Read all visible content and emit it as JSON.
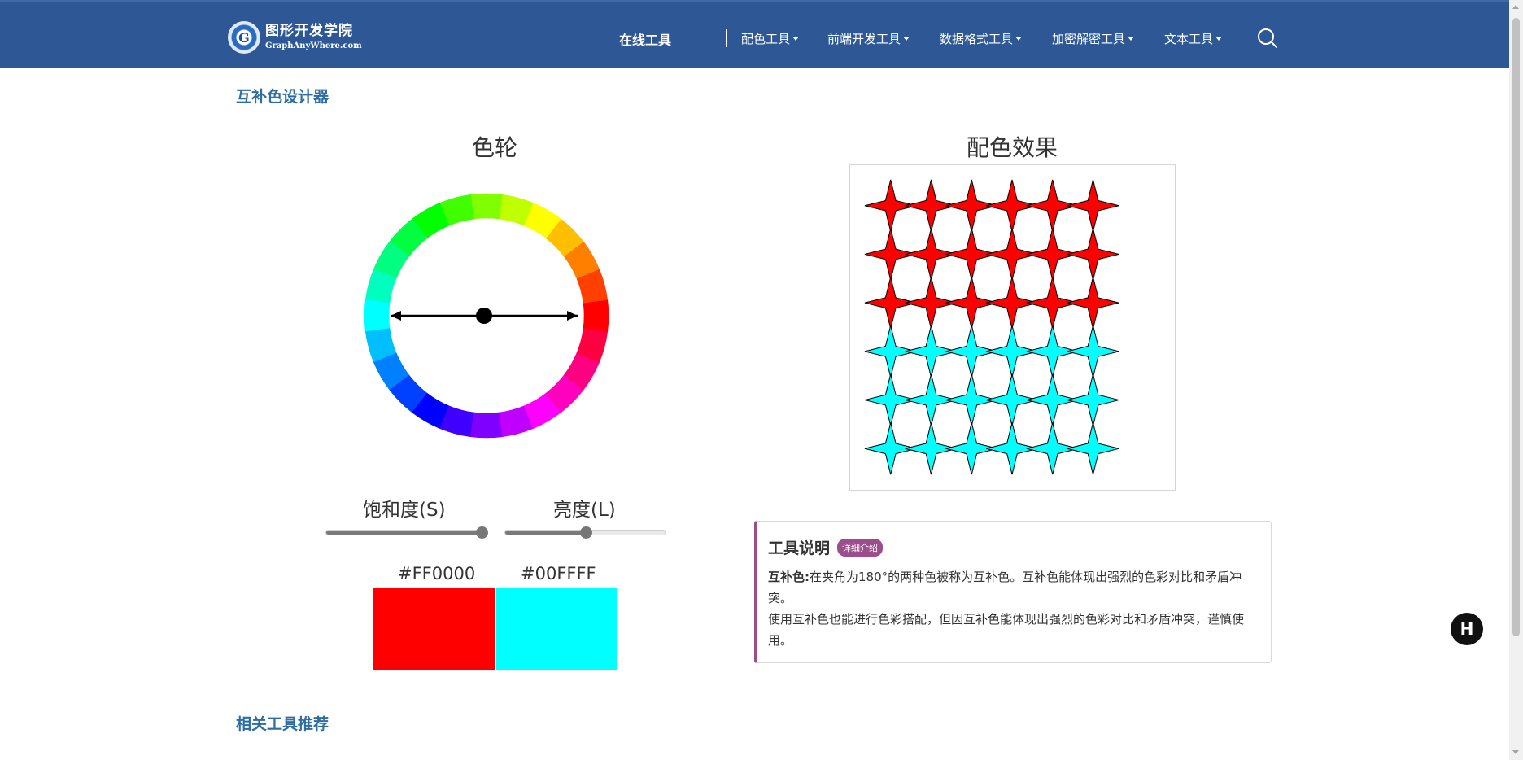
{
  "header": {
    "logo_cn": "图形开发学院",
    "logo_en": "GraphAnyWhere.com",
    "logo_icon": "logo-globe-icon",
    "nav_online": "在线工具",
    "nav_items": [
      "配色工具",
      "前端开发工具",
      "数据格式工具",
      "加密解密工具",
      "文本工具"
    ],
    "search_icon": "search-icon",
    "bg_color": "#2d5795"
  },
  "page": {
    "title": "互补色设计器",
    "related_title": "相关工具推荐"
  },
  "wheel": {
    "heading": "色轮",
    "segments": 24,
    "selected_hue_deg": 0,
    "complement_hue_deg": 180
  },
  "effect": {
    "heading": "配色效果",
    "grid_cols": 6,
    "grid_rows": 6,
    "top_rows": 3,
    "color_primary": "#FF0000",
    "color_complement": "#00FFFF"
  },
  "controls": {
    "saturation_label": "饱和度(S)",
    "saturation_value": 1.0,
    "lightness_label": "亮度(L)",
    "lightness_value": 0.5
  },
  "colors": {
    "primary_hex": "#FF0000",
    "complement_hex": "#00FFFF"
  },
  "info": {
    "title": "工具说明",
    "badge": "详细介绍",
    "term": "互补色:",
    "line1": "在夹角为180°的两种色被称为互补色。互补色能体现出强烈的色彩对比和矛盾冲突。",
    "line2": "使用互补色也能进行色彩搭配，但因互补色能体现出强烈的色彩对比和矛盾冲突，谨慎使用。",
    "accent_color": "#9c4d8c"
  },
  "float_button": {
    "label": "H",
    "icon": "assistant-icon"
  }
}
